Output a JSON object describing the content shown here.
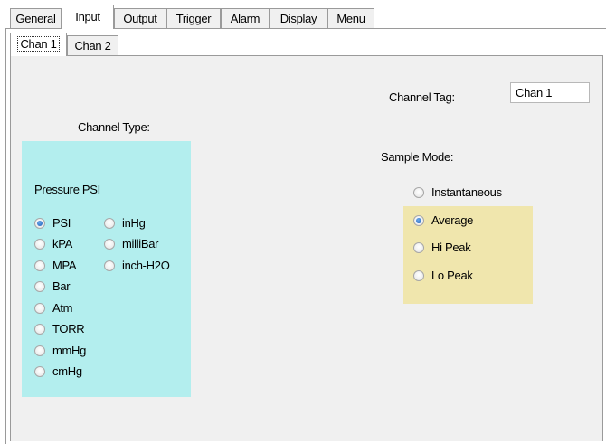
{
  "main_tabs": [
    {
      "label": "General",
      "active": false
    },
    {
      "label": "Input",
      "active": true
    },
    {
      "label": "Output",
      "active": false
    },
    {
      "label": "Trigger",
      "active": false
    },
    {
      "label": "Alarm",
      "active": false
    },
    {
      "label": "Display",
      "active": false
    },
    {
      "label": "Menu",
      "active": false
    }
  ],
  "sub_tabs": [
    {
      "label": "Chan 1",
      "active": true
    },
    {
      "label": "Chan 2",
      "active": false
    }
  ],
  "channel_tag": {
    "label": "Channel Tag:",
    "value": "Chan 1"
  },
  "channel_type": {
    "label": "Channel Type:",
    "group_label": "Pressure PSI",
    "selected": "PSI",
    "options_col1": [
      "PSI",
      "kPA",
      "MPA",
      "Bar",
      "Atm",
      "TORR",
      "mmHg",
      "cmHg"
    ],
    "options_col2": [
      "inHg",
      "milliBar",
      "inch-H2O"
    ]
  },
  "sample_mode": {
    "label": "Sample Mode:",
    "selected": "Average",
    "options": [
      "Instantaneous",
      "Average",
      "Hi Peak",
      "Lo Peak"
    ]
  },
  "colors": {
    "channel_type_bg": "#b3eeee",
    "sample_mode_highlight": "#f0e6ad",
    "panel_bg": "#f0f0f0",
    "radio_dot": "#1c5fb8"
  }
}
